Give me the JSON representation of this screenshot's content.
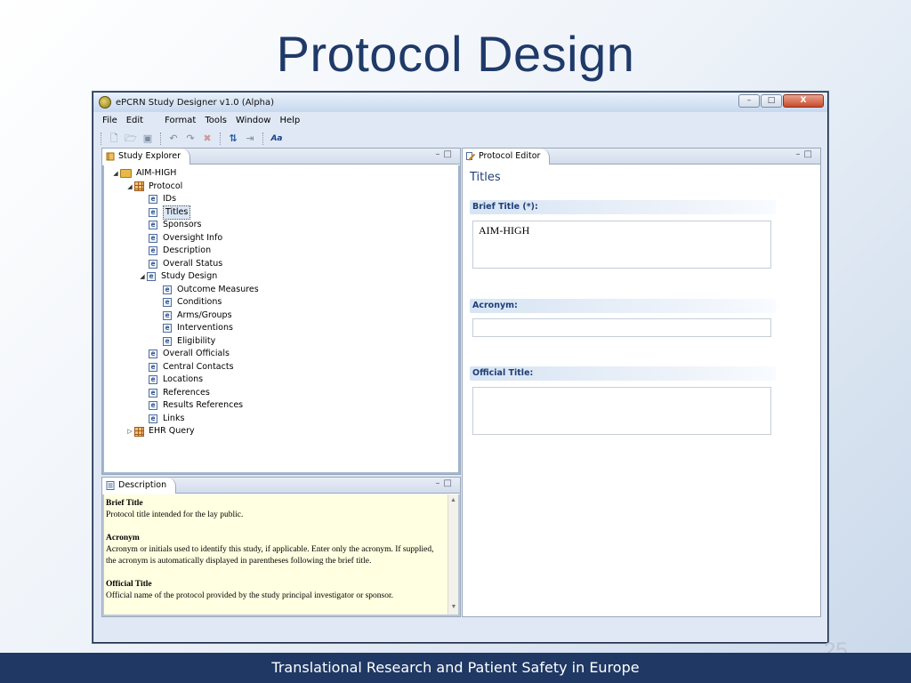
{
  "slide": {
    "title": "Protocol Design",
    "footer": "Translational Research and Patient Safety in Europe",
    "page_number": "25"
  },
  "window": {
    "title": "ePCRN Study Designer v1.0 (Alpha)",
    "controls": {
      "minimize": "–",
      "maximize": "□",
      "close": "X"
    }
  },
  "menubar": [
    "File",
    "Edit",
    "Format",
    "Tools",
    "Window",
    "Help"
  ],
  "toolbar": {
    "icons": [
      "new-icon",
      "open-folder-icon",
      "save-icon",
      "undo-icon",
      "redo-icon",
      "delete-icon",
      "sort-az-icon",
      "import-icon",
      "font-icon"
    ],
    "font_label": "Aa"
  },
  "study_explorer": {
    "tab_label": "Study Explorer",
    "tree": {
      "root": "AIM-HIGH",
      "protocol": "Protocol",
      "protocol_items": [
        "IDs",
        "Titles",
        "Sponsors",
        "Oversight Info",
        "Description",
        "Overall Status",
        "Study Design"
      ],
      "study_design_items": [
        "Outcome Measures",
        "Conditions",
        "Arms/Groups",
        "Interventions",
        "Eligibility"
      ],
      "after_items": [
        "Overall Officials",
        "Central Contacts",
        "Locations",
        "References",
        "Results References",
        "Links"
      ],
      "ehr_query": "EHR Query",
      "selected": "Titles",
      "item_icon_letter": "e"
    }
  },
  "description_panel": {
    "tab_label": "Description",
    "sections": [
      {
        "heading": "Brief Title",
        "text": "Protocol title intended for the lay public."
      },
      {
        "heading": "Acronym",
        "text": "Acronym or initials used to identify this study, if applicable. Enter only the acronym. If supplied, the acronym is automatically displayed in parentheses following the brief title."
      },
      {
        "heading": "Official Title",
        "text": "Official name of the protocol provided by the study principal investigator or sponsor."
      }
    ]
  },
  "protocol_editor": {
    "tab_label": "Protocol Editor",
    "heading": "Titles",
    "fields": {
      "brief_title": {
        "label": "Brief Title (*):",
        "value": "AIM-HIGH"
      },
      "acronym": {
        "label": "Acronym:",
        "value": ""
      },
      "official_title": {
        "label": "Official Title:",
        "value": ""
      }
    }
  }
}
